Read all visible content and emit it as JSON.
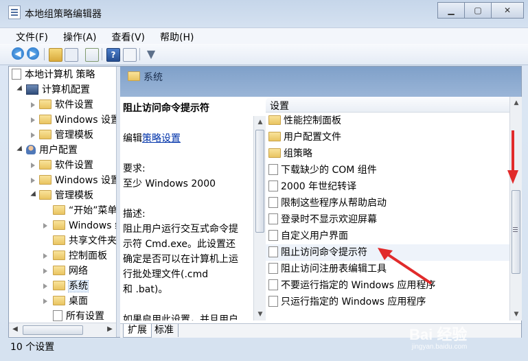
{
  "window": {
    "title": "本地组策略编辑器"
  },
  "menu": [
    "文件(F)",
    "操作(A)",
    "查看(V)",
    "帮助(H)"
  ],
  "toolbar_icons": [
    "back-arrow-icon",
    "forward-arrow-icon",
    "up-folder-icon",
    "show-hide-tree-icon",
    "export-list-icon",
    "help-icon",
    "properties-icon",
    "filter-icon"
  ],
  "tree": {
    "root": "本地计算机 策略",
    "items": [
      {
        "label": "计算机配置",
        "level": 1,
        "expanded": true,
        "icon": "computer-icon"
      },
      {
        "label": "软件设置",
        "level": 2,
        "expanded": false,
        "icon": "folder-icon"
      },
      {
        "label": "Windows 设置",
        "level": 2,
        "expanded": false,
        "icon": "folder-icon"
      },
      {
        "label": "管理模板",
        "level": 2,
        "expanded": false,
        "icon": "folder-icon"
      },
      {
        "label": "用户配置",
        "level": 1,
        "expanded": true,
        "icon": "user-icon"
      },
      {
        "label": "软件设置",
        "level": 2,
        "expanded": false,
        "icon": "folder-icon"
      },
      {
        "label": "Windows 设置",
        "level": 2,
        "expanded": false,
        "icon": "folder-icon"
      },
      {
        "label": "管理模板",
        "level": 2,
        "expanded": true,
        "icon": "folder-icon"
      },
      {
        "label": "“开始”菜单",
        "level": 3,
        "expanded": null,
        "icon": "folder-icon"
      },
      {
        "label": "Windows 组件",
        "level": 3,
        "expanded": false,
        "icon": "folder-icon"
      },
      {
        "label": "共享文件夹",
        "level": 3,
        "expanded": null,
        "icon": "folder-icon"
      },
      {
        "label": "控制面板",
        "level": 3,
        "expanded": false,
        "icon": "folder-icon"
      },
      {
        "label": "网络",
        "level": 3,
        "expanded": false,
        "icon": "folder-icon"
      },
      {
        "label": "系统",
        "level": 3,
        "expanded": false,
        "icon": "folder-icon",
        "selected": true
      },
      {
        "label": "桌面",
        "level": 3,
        "expanded": false,
        "icon": "folder-icon"
      },
      {
        "label": "所有设置",
        "level": 3,
        "expanded": null,
        "icon": "document-icon"
      }
    ]
  },
  "section": {
    "title": "系统"
  },
  "description": {
    "title": "阻止访问命令提示符",
    "edit_prefix": "编辑",
    "edit_link": "策略设置",
    "requirement_label": "要求:",
    "requirement_value": "至少 Windows 2000",
    "description_label": "描述:",
    "description_lines": [
      "阻止用户运行交互式命令提",
      "示符 Cmd.exe。此设置还",
      "确定是否可以在计算机上运",
      "行批处理文件(.cmd",
      "和 .bat)。"
    ],
    "cutoff_line": "如果启用此设置，并且用户"
  },
  "list": {
    "header": "设置",
    "items": [
      {
        "label": "性能控制面板",
        "icon": "folder-icon"
      },
      {
        "label": "用户配置文件",
        "icon": "folder-icon"
      },
      {
        "label": "组策略",
        "icon": "folder-icon"
      },
      {
        "label": "下载缺少的 COM 组件",
        "icon": "policy-icon"
      },
      {
        "label": "2000 年世纪转译",
        "icon": "policy-icon"
      },
      {
        "label": "限制这些程序从帮助启动",
        "icon": "policy-icon"
      },
      {
        "label": "登录时不显示欢迎屏幕",
        "icon": "policy-icon"
      },
      {
        "label": "自定义用户界面",
        "icon": "policy-icon"
      },
      {
        "label": "阻止访问命令提示符",
        "icon": "policy-icon",
        "highlighted": true
      },
      {
        "label": "阻止访问注册表编辑工具",
        "icon": "policy-icon"
      },
      {
        "label": "不要运行指定的 Windows 应用程序",
        "icon": "policy-icon"
      },
      {
        "label": "只运行指定的 Windows 应用程序",
        "icon": "policy-icon"
      }
    ]
  },
  "tabs": [
    "扩展",
    "标准"
  ],
  "status": "10 个设置",
  "accent_colors": {
    "section_header": "#8aa8cf",
    "annotation_arrow": "#e12b2b",
    "link": "#0033aa"
  },
  "watermark": {
    "text": "Bai 经验",
    "sub": "jingyan.baidu.com"
  }
}
